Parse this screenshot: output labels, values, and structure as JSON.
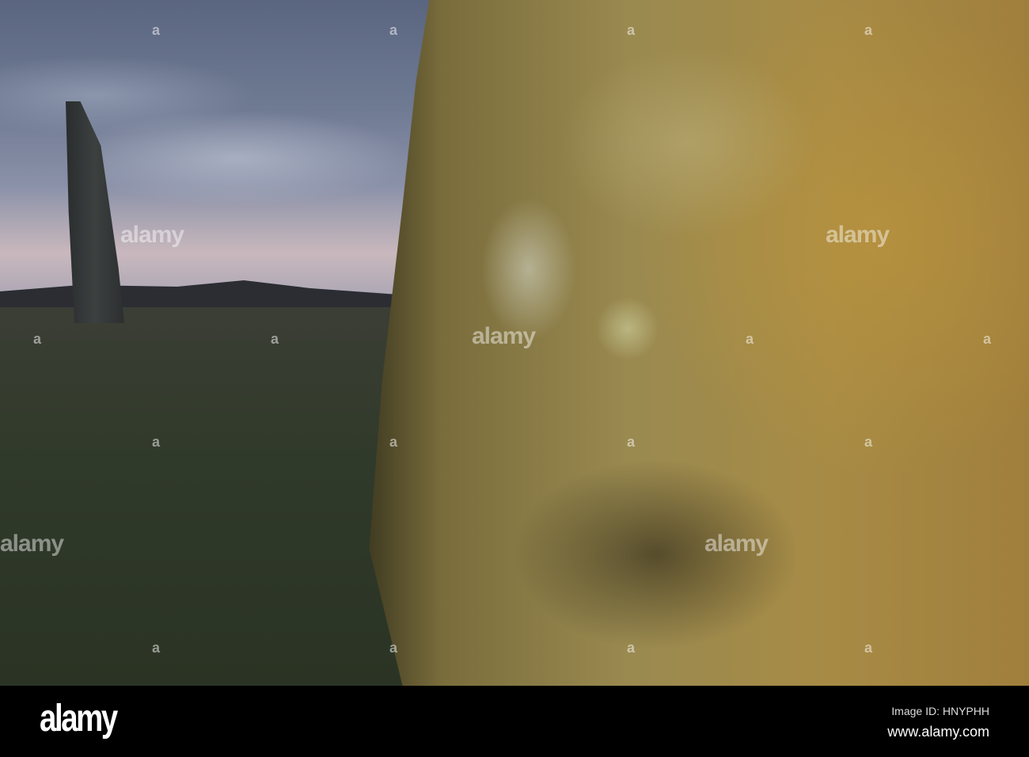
{
  "watermark": {
    "text": "alamy",
    "mark": "a"
  },
  "footer": {
    "logo": "alamy",
    "image_id": "Image ID: HNYPHH",
    "site": "www.alamy.com"
  }
}
